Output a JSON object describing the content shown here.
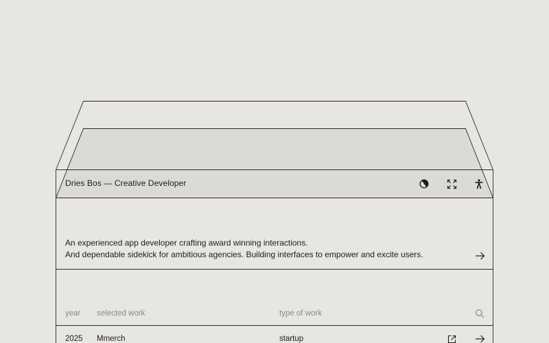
{
  "header": {
    "title": "Dries Bos — Creative Developer",
    "icons": [
      "contrast-icon",
      "expand-icon",
      "accessibility-icon"
    ]
  },
  "intro": {
    "line1": "An experienced app  developer crafting award winning interactions.",
    "line2": "And dependable sidekick for ambitious agencies. Building interfaces to empower and excite users."
  },
  "table": {
    "columns": {
      "year": "year",
      "work": "selected work",
      "type": "type of work"
    },
    "rows": [
      {
        "year": "2025",
        "work": "Mmerch",
        "type": "startup"
      }
    ]
  },
  "colors": {
    "background": "#e8e6e1",
    "panel": "#dcdad5",
    "line": "#2a2a2a",
    "muted_text": "#8a8885"
  }
}
